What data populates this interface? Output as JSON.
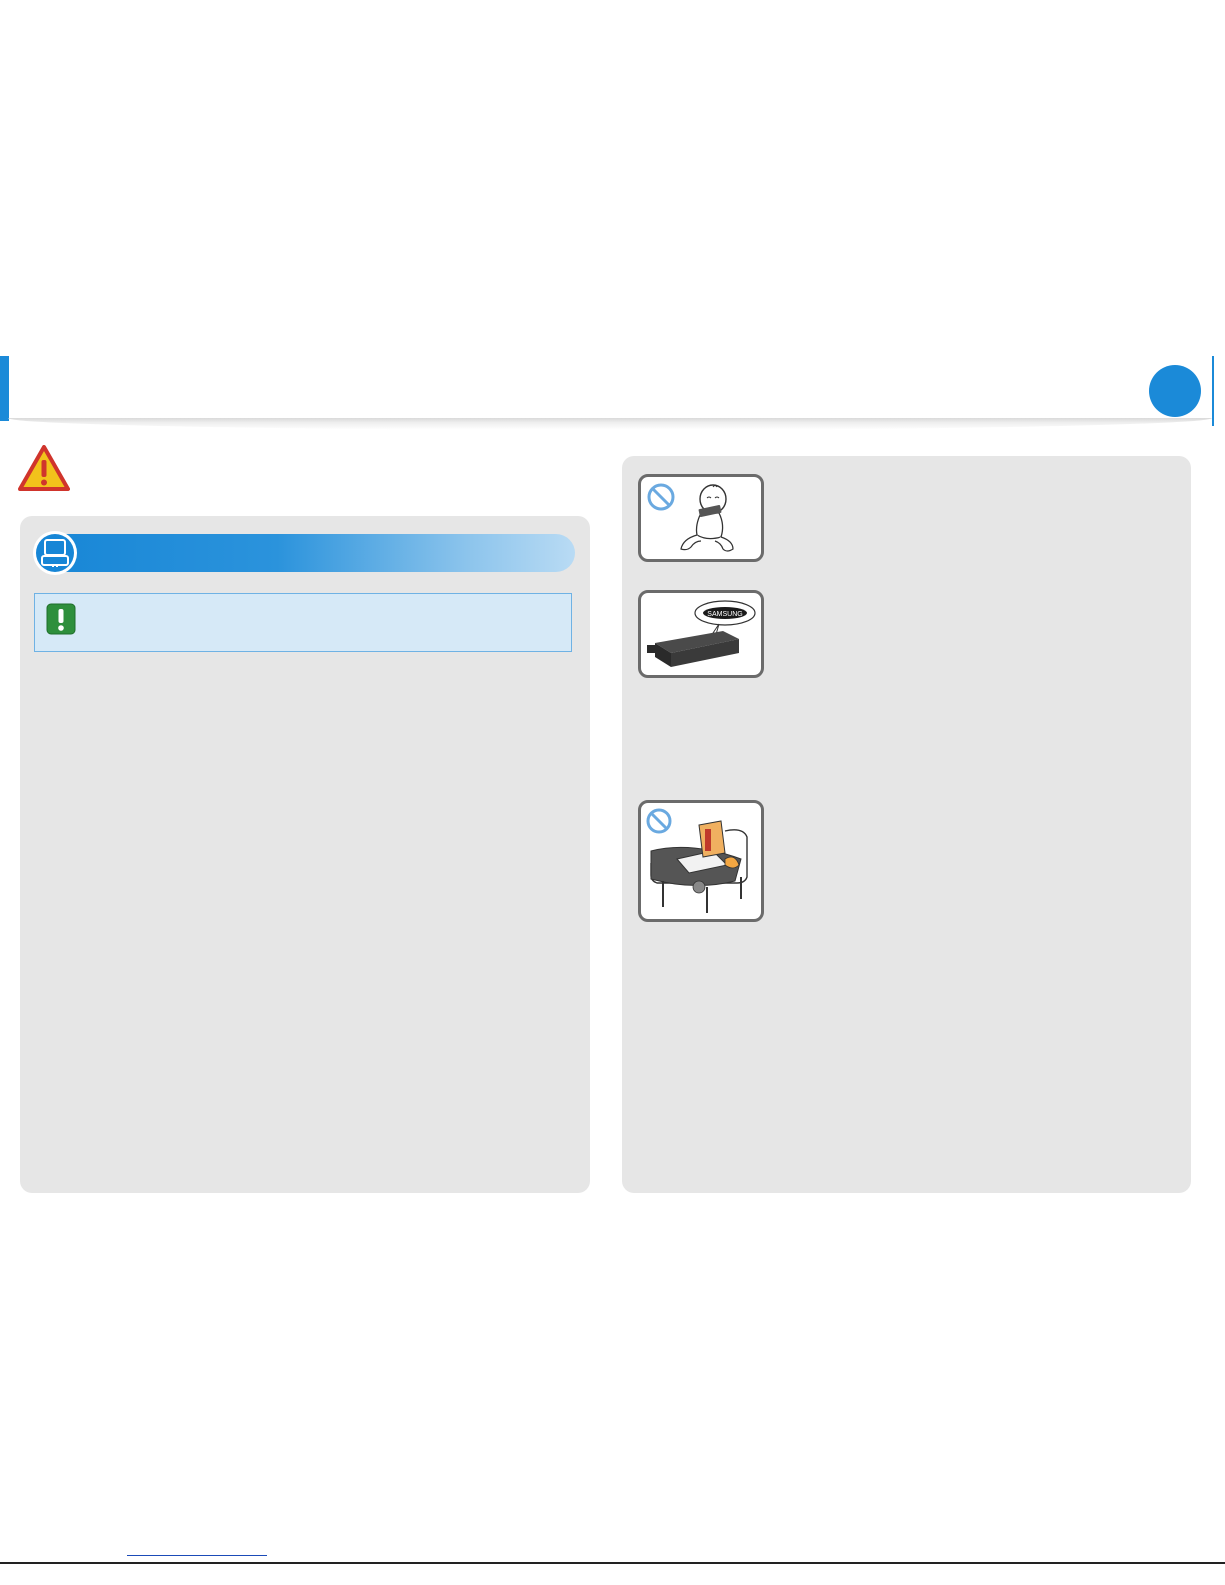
{
  "header": {
    "accent_color": "#1b8ad8",
    "chapter_indicator": "",
    "section_warning_icon": "warning-triangle-icon"
  },
  "left_panel": {
    "section_title": "",
    "section_icon": "laptop-battery-icon",
    "caution_icon": "exclamation-icon",
    "caution_text": ""
  },
  "right_panel": {
    "items": [
      {
        "illustration": "baby-chewing-battery",
        "prohibited": true,
        "text": ""
      },
      {
        "illustration": "samsung-battery",
        "prohibited": false,
        "label": "SAMSUNG",
        "text": ""
      },
      {
        "illustration": "laptop-on-bed",
        "prohibited": true,
        "text": ""
      }
    ]
  },
  "footer": {
    "link_text": ""
  }
}
